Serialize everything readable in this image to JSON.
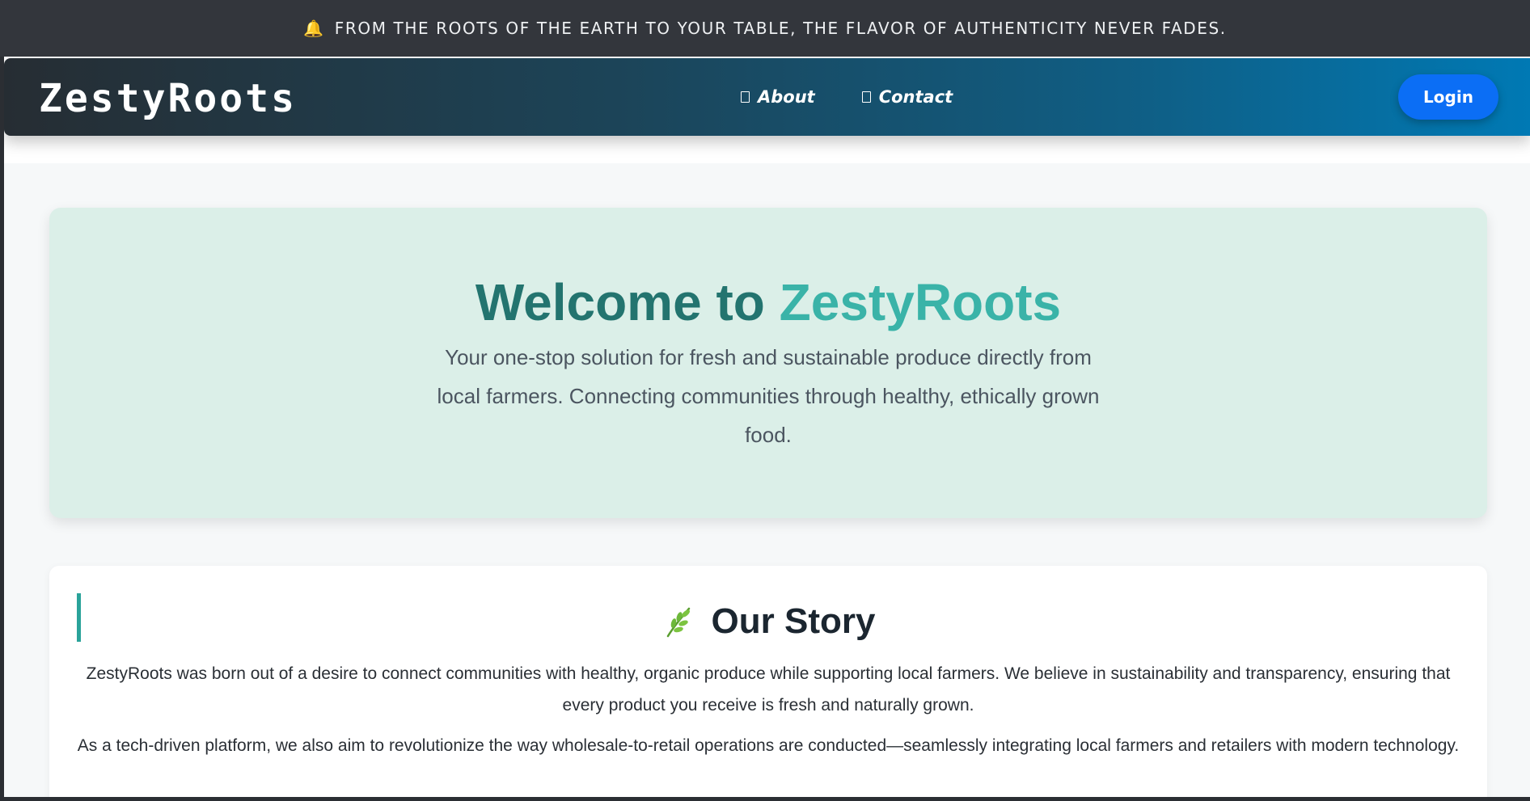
{
  "announcement": {
    "icon": "bell-icon",
    "text": "FROM THE ROOTS OF THE EARTH TO YOUR TABLE, THE FLAVOR OF AUTHENTICITY NEVER FADES."
  },
  "navbar": {
    "brand": "ZestyRoots",
    "links": [
      {
        "label": "About",
        "icon": "box-glyph-icon"
      },
      {
        "label": "Contact",
        "icon": "box-glyph-icon"
      }
    ],
    "login_label": "Login",
    "colors": {
      "gradient_start": "#262d33",
      "gradient_end": "#0079b4",
      "login": "#0b6ef5"
    }
  },
  "hero": {
    "title_prefix": "Welcome to",
    "title_accent": "ZestyRoots",
    "subtitle": "Your one-stop solution for fresh and sustainable produce directly from local farmers. Connecting communities through healthy, ethically grown food.",
    "colors": {
      "title": "#23746f",
      "accent": "#3ab3a8",
      "background": "#dbefe8"
    }
  },
  "story": {
    "icon": "leaf-icon",
    "heading": "Our Story",
    "paragraphs": [
      "ZestyRoots was born out of a desire to connect communities with healthy, organic produce while supporting local farmers. We believe in sustainability and transparency, ensuring that every product you receive is fresh and naturally grown.",
      "As a tech-driven platform, we also aim to revolutionize the way wholesale-to-retail operations are conducted—seamlessly integrating local farmers and retailers with modern technology."
    ]
  }
}
